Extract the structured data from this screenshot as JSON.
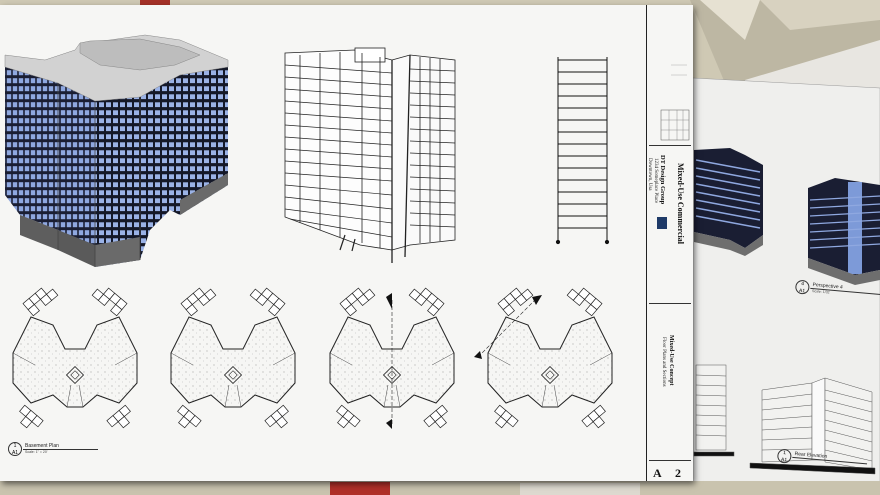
{
  "sheet": {
    "firm": "DT Design Group",
    "address_line1": "1234 Someplace Place",
    "address_line2": "Downtown, Usa",
    "project": "Mixed-Use Commercial",
    "sheet_title": "Mixed-Use Concept",
    "sheet_subtitle": "Floor Plans and Sections",
    "sheet_letter": "A",
    "sheet_number": "2"
  },
  "views": {
    "basement": {
      "number": "1",
      "sheet": "A1",
      "name": "Basement Plan",
      "scale": "Scale: 1\" = 20'"
    }
  },
  "background_sheet": {
    "perspective": {
      "number": "4",
      "sheet": "A1",
      "name": "Perspective 4",
      "scale": "Scale: 1/32"
    },
    "rear": {
      "number": "1",
      "sheet": "A1",
      "name": "Rear Elevation"
    }
  },
  "colors": {
    "glass": "#8fa8e0",
    "mullion": "#1a1e33",
    "sheet": "#f6f6f4",
    "logo": "#1e3a68"
  }
}
